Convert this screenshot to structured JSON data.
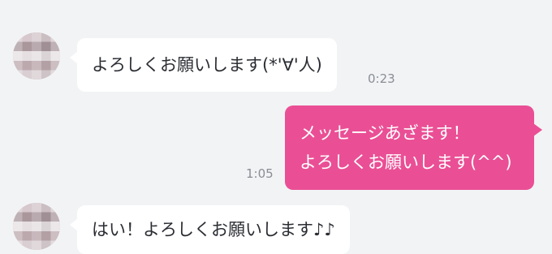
{
  "messages": [
    {
      "direction": "incoming",
      "text": "よろしくお願いします(*'∀'人)",
      "time": "0:23"
    },
    {
      "direction": "outgoing",
      "lines": [
        "メッセージあざます！",
        "よろしくお願いします(^^)"
      ],
      "time": "1:05"
    },
    {
      "direction": "incoming",
      "text": "はい！よろしくお願いします♪♪",
      "time": ""
    }
  ],
  "colors": {
    "background": "#f2f3f5",
    "incoming_bubble": "#ffffff",
    "outgoing_bubble": "#ea4f95",
    "time_text": "#8a8d94"
  }
}
